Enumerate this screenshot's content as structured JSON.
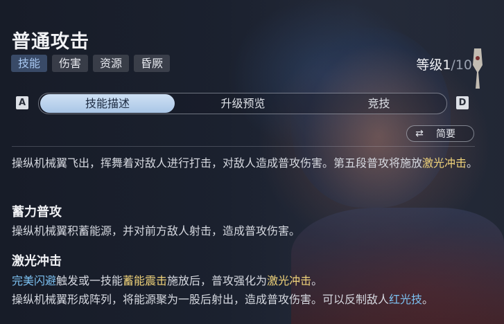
{
  "skill": {
    "title": "普通攻击",
    "tags": [
      "技能",
      "伤害",
      "资源",
      "昏厥"
    ],
    "level_label": "等级",
    "level_current": "1",
    "level_max": "/10"
  },
  "tabs": {
    "key_left": "A",
    "key_right": "D",
    "items": [
      "技能描述",
      "升级预览",
      "竞技"
    ],
    "active_index": 0
  },
  "summary_toggle": {
    "label": "简要",
    "icon": "swap-icon"
  },
  "description": {
    "intro_a": "操纵机械翼飞出，挥舞着对敌人进行打击，对敌人造成普攻伤害。第五段普攻将施放",
    "intro_hl": "激光冲击",
    "intro_b": "。",
    "section1_title": "蓄力普攻",
    "section1_text": "操纵机械翼积蓄能源，并对前方敌人射击，造成普攻伤害。",
    "section2_title": "激光冲击",
    "s2_l1_hl1": "完美闪避",
    "s2_l1_t1": "触发或一技能",
    "s2_l1_hl2": "蓄能震击",
    "s2_l1_t2": "施放后，普攻强化为",
    "s2_l1_hl3": "激光冲击",
    "s2_l1_t3": "。",
    "s2_l2_t1": "操纵机械翼形成阵列，将能源聚为一股后射出，造成普攻伤害。可以反制敌人",
    "s2_l2_hl": "红光技",
    "s2_l2_t2": "。"
  },
  "colors": {
    "highlight_yellow": "#f0d37a",
    "highlight_blue": "#7cc0f0",
    "active_tab": "#bcd4ee"
  }
}
